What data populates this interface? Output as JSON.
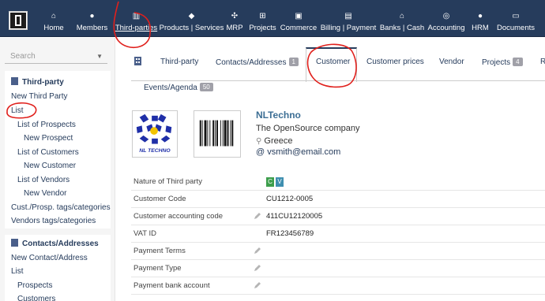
{
  "menu": [
    {
      "label": "Home",
      "icon": "home-icon",
      "glyph": "⌂"
    },
    {
      "label": "Members",
      "icon": "members-icon",
      "glyph": "●"
    },
    {
      "label": "Third-parties",
      "icon": "building-icon",
      "glyph": "▥"
    },
    {
      "label": "Products | Services",
      "icon": "cube-icon",
      "glyph": "◆"
    },
    {
      "label": "MRP",
      "icon": "cubes-icon",
      "glyph": "✣"
    },
    {
      "label": "Projects",
      "icon": "sitemap-icon",
      "glyph": "⊞"
    },
    {
      "label": "Commerce",
      "icon": "suitcase-icon",
      "glyph": "▣"
    },
    {
      "label": "Billing | Payment",
      "icon": "invoice-icon",
      "glyph": "▤"
    },
    {
      "label": "Banks | Cash",
      "icon": "bank-icon",
      "glyph": "⌂"
    },
    {
      "label": "Accounting",
      "icon": "calculator-icon",
      "glyph": "◎"
    },
    {
      "label": "HRM",
      "icon": "user-tie-icon",
      "glyph": "●"
    },
    {
      "label": "Documents",
      "icon": "file-icon",
      "glyph": "▭"
    }
  ],
  "sidebar": {
    "search_placeholder": "Search",
    "section1_title": "Third-party",
    "section1_items": [
      "New Third Party",
      "List",
      "List of Prospects",
      "New Prospect",
      "List of Customers",
      "New Customer",
      "List of Vendors",
      "New Vendor",
      "Cust./Prosp. tags/categories",
      "Vendors tags/categories"
    ],
    "section2_title": "Contacts/Addresses",
    "section2_items": [
      "New Contact/Address",
      "List",
      "Prospects",
      "Customers"
    ]
  },
  "tabs": {
    "third_party": "Third-party",
    "contacts": "Contacts/Addresses",
    "contacts_count": "1",
    "customer": "Customer",
    "customer_prices": "Customer prices",
    "vendor": "Vendor",
    "projects": "Projects",
    "projects_count": "4",
    "events": "Events/Agenda",
    "events_count": "50"
  },
  "company": {
    "logo_text": "NL TECHNO",
    "name": "NLTechno",
    "description": "The OpenSource company",
    "country": "Greece",
    "email": "vsmith@email.com"
  },
  "fields": [
    {
      "label": "Nature of Third party",
      "value": ""
    },
    {
      "label": "Customer Code",
      "value": "CU1212-0005"
    },
    {
      "label": "Customer accounting code",
      "value": "411CU12120005"
    },
    {
      "label": "VAT ID",
      "value": "FR123456789"
    },
    {
      "label": "Payment Terms",
      "value": ""
    },
    {
      "label": "Payment Type",
      "value": ""
    },
    {
      "label": "Payment bank account",
      "value": ""
    }
  ],
  "nature_tags": [
    {
      "letter": "C",
      "color": "#3d9e4c"
    },
    {
      "letter": "V",
      "color": "#3f8fb0"
    }
  ],
  "colors": {
    "topbar": "#263c5c",
    "annotation": "#e0201c",
    "link": "#263c5c"
  }
}
